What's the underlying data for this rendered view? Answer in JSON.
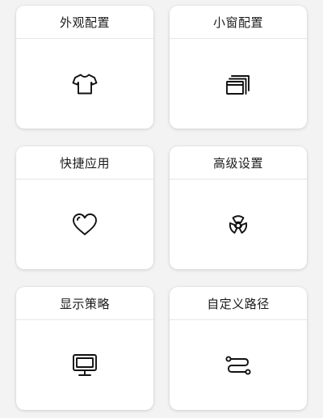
{
  "cards": [
    {
      "title": "外观配置",
      "icon": "tshirt-icon"
    },
    {
      "title": "小窗配置",
      "icon": "windows-icon"
    },
    {
      "title": "快捷应用",
      "icon": "heart-icon"
    },
    {
      "title": "高级设置",
      "icon": "radiation-icon"
    },
    {
      "title": "显示策略",
      "icon": "monitor-icon"
    },
    {
      "title": "自定义路径",
      "icon": "path-icon"
    }
  ]
}
